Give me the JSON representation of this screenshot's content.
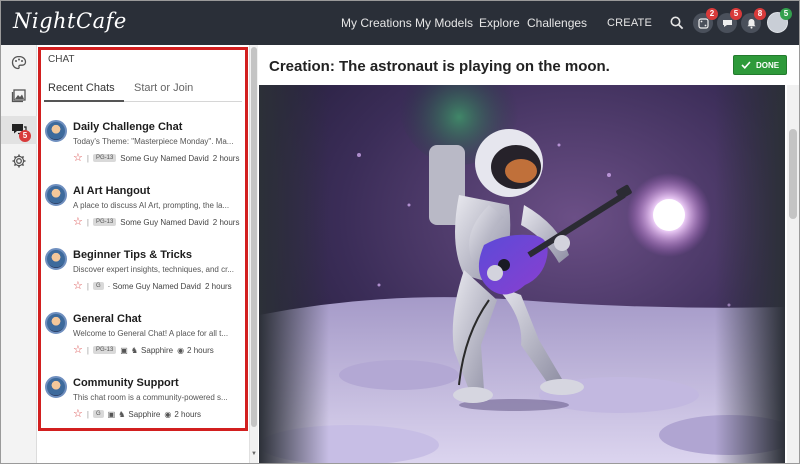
{
  "app": {
    "logo": "NightCafe"
  },
  "nav": {
    "items": [
      "My Creations",
      "My Models",
      "Explore",
      "Challenges"
    ],
    "create": "CREATE"
  },
  "notifications": {
    "dice_badge": "2",
    "messages_badge": "5",
    "bell_badge": "8",
    "avatar_badge": "5"
  },
  "rail": {
    "chat_badge": "5"
  },
  "chat": {
    "header": "CHAT",
    "tabs": [
      "Recent Chats",
      "Start or Join"
    ],
    "rooms": [
      {
        "title": "Daily Challenge Chat",
        "desc": "Today's Theme: \"Masterpiece Monday\". Ma...",
        "rating": "PG-13",
        "user": "Some Guy Named David",
        "time": "2 hours"
      },
      {
        "title": "AI Art Hangout",
        "desc": "A place to discuss AI Art, prompting, the la...",
        "rating": "PG-13",
        "user": "Some Guy Named David",
        "time": "2 hours"
      },
      {
        "title": "Beginner Tips & Tricks",
        "desc": "Discover expert insights, techniques, and cr...",
        "rating": "G",
        "user": "· Some Guy Named David",
        "time": "2 hours"
      },
      {
        "title": "General Chat",
        "desc": "Welcome to General Chat! A place for all t...",
        "rating": "PG-13",
        "user": "Sapphire",
        "time": "2 hours"
      },
      {
        "title": "Community Support",
        "desc": "This chat room is a community-powered s...",
        "rating": "G",
        "user": "Sapphire",
        "time": "2 hours"
      }
    ]
  },
  "creation": {
    "title": "Creation: The astronaut is playing on the moon.",
    "done": "DONE"
  },
  "colors": {
    "accent_done": "#2e9a3a",
    "highlight_border": "#d21f1f",
    "topbar": "#2a2f38"
  }
}
